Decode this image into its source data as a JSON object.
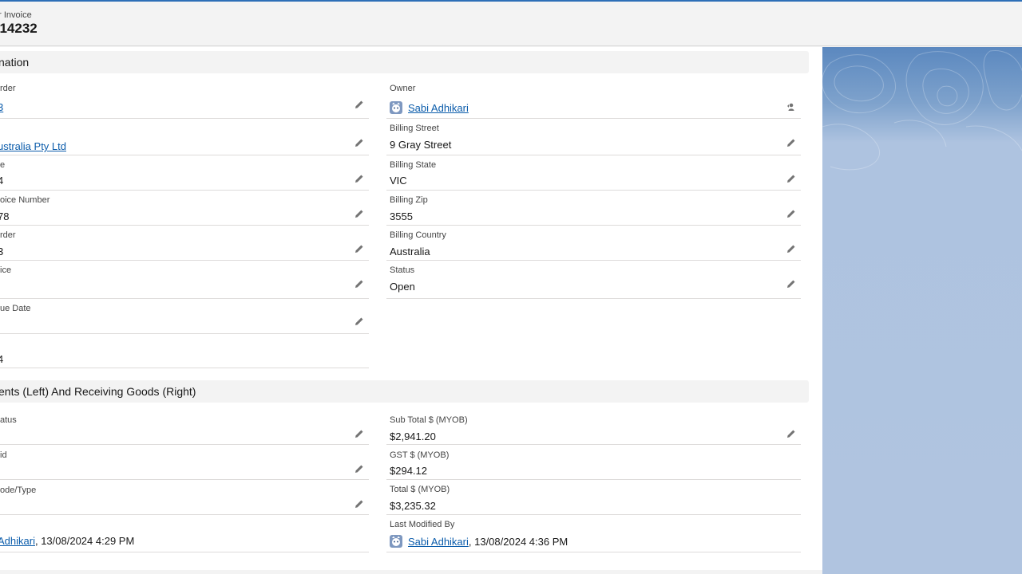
{
  "header": {
    "object_type": "or Invoice",
    "record_number": "014232"
  },
  "sections": {
    "information": "nation",
    "payments": "ents (Left) And Receiving Goods (Right)"
  },
  "left_fields": [
    {
      "label": "rder",
      "value": "3"
    },
    {
      "label": "",
      "value": "ustralia Pty Ltd"
    },
    {
      "label": "e",
      "value": "4"
    },
    {
      "label": "oice Number",
      "value": "78"
    },
    {
      "label": "rder",
      "value": "3"
    },
    {
      "label": "ice",
      "value": ""
    },
    {
      "label": "ue Date",
      "value": ""
    },
    {
      "label": "",
      "value": "4"
    }
  ],
  "right_fields": [
    {
      "label": "Owner",
      "value": "Sabi Adhikari"
    },
    {
      "label": "Billing Street",
      "value": "9 Gray Street"
    },
    {
      "label": "Billing State",
      "value": "VIC"
    },
    {
      "label": "Billing Zip",
      "value": "3555"
    },
    {
      "label": "Billing Country",
      "value": "Australia"
    },
    {
      "label": "Status",
      "value": "Open"
    }
  ],
  "pay_left": [
    {
      "label": "atus",
      "value": ""
    },
    {
      "label": "id",
      "value": ""
    },
    {
      "label": "ode/Type",
      "value": ""
    },
    {
      "label": "",
      "value_link": "Adhikari",
      "value_rest": ", 13/08/2024 4:29 PM"
    }
  ],
  "pay_right": [
    {
      "label": "Sub Total $ (MYOB)",
      "value": "$2,941.20"
    },
    {
      "label": "GST $ (MYOB)",
      "value": "$294.12"
    },
    {
      "label": "Total $ (MYOB)",
      "value": "$3,235.32"
    },
    {
      "label": "Last Modified By",
      "value_link": "Sabi Adhikari",
      "value_rest": ", 13/08/2024 4:36 PM"
    }
  ],
  "icons": {
    "edit": "pencil-icon",
    "change_owner": "change-owner-icon",
    "avatar": "user-avatar-icon"
  }
}
